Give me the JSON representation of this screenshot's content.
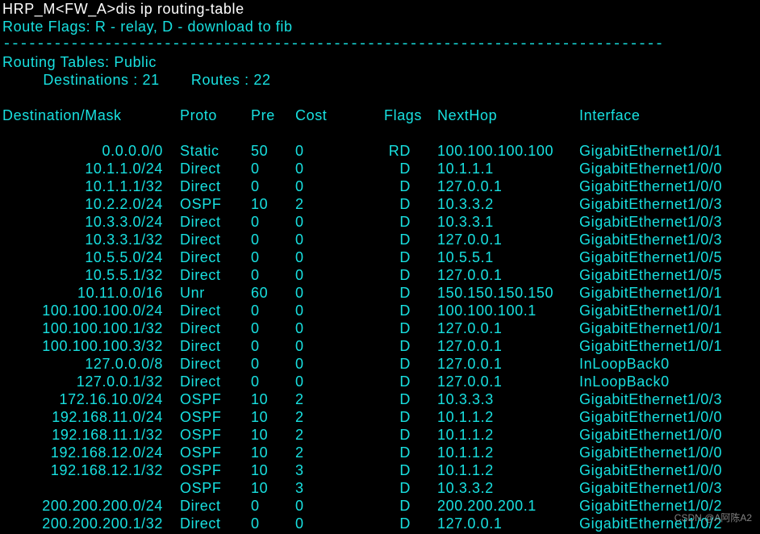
{
  "terminal": {
    "prompt": "HRP_M<FW_A>",
    "command": "dis ip routing-table",
    "flags_legend": "Route Flags: R - relay, D - download to fib",
    "rule": "------------------------------------------------------------------------------",
    "tables_title": "Routing Tables: Public",
    "summary": "         Destinations : 21       Routes : 22",
    "headers": {
      "dest": "Destination/Mask",
      "proto": "Proto",
      "pre": "Pre",
      "cost": "Cost",
      "flags": "Flags",
      "nexthop": "NextHop",
      "interface": "Interface"
    },
    "routes": [
      {
        "dest": "0.0.0.0/0",
        "proto": "Static",
        "pre": "50",
        "cost": "0",
        "flags": "RD",
        "nexthop": "100.100.100.100",
        "iface": "GigabitEthernet1/0/1"
      },
      {
        "dest": "10.1.1.0/24",
        "proto": "Direct",
        "pre": "0",
        "cost": "0",
        "flags": "D",
        "nexthop": "10.1.1.1",
        "iface": "GigabitEthernet1/0/0"
      },
      {
        "dest": "10.1.1.1/32",
        "proto": "Direct",
        "pre": "0",
        "cost": "0",
        "flags": "D",
        "nexthop": "127.0.0.1",
        "iface": "GigabitEthernet1/0/0"
      },
      {
        "dest": "10.2.2.0/24",
        "proto": "OSPF",
        "pre": "10",
        "cost": "2",
        "flags": "D",
        "nexthop": "10.3.3.2",
        "iface": "GigabitEthernet1/0/3"
      },
      {
        "dest": "10.3.3.0/24",
        "proto": "Direct",
        "pre": "0",
        "cost": "0",
        "flags": "D",
        "nexthop": "10.3.3.1",
        "iface": "GigabitEthernet1/0/3"
      },
      {
        "dest": "10.3.3.1/32",
        "proto": "Direct",
        "pre": "0",
        "cost": "0",
        "flags": "D",
        "nexthop": "127.0.0.1",
        "iface": "GigabitEthernet1/0/3"
      },
      {
        "dest": "10.5.5.0/24",
        "proto": "Direct",
        "pre": "0",
        "cost": "0",
        "flags": "D",
        "nexthop": "10.5.5.1",
        "iface": "GigabitEthernet1/0/5"
      },
      {
        "dest": "10.5.5.1/32",
        "proto": "Direct",
        "pre": "0",
        "cost": "0",
        "flags": "D",
        "nexthop": "127.0.0.1",
        "iface": "GigabitEthernet1/0/5"
      },
      {
        "dest": "10.11.0.0/16",
        "proto": "Unr",
        "pre": "60",
        "cost": "0",
        "flags": "D",
        "nexthop": "150.150.150.150",
        "iface": "GigabitEthernet1/0/1"
      },
      {
        "dest": "100.100.100.0/24",
        "proto": "Direct",
        "pre": "0",
        "cost": "0",
        "flags": "D",
        "nexthop": "100.100.100.1",
        "iface": "GigabitEthernet1/0/1"
      },
      {
        "dest": "100.100.100.1/32",
        "proto": "Direct",
        "pre": "0",
        "cost": "0",
        "flags": "D",
        "nexthop": "127.0.0.1",
        "iface": "GigabitEthernet1/0/1"
      },
      {
        "dest": "100.100.100.3/32",
        "proto": "Direct",
        "pre": "0",
        "cost": "0",
        "flags": "D",
        "nexthop": "127.0.0.1",
        "iface": "GigabitEthernet1/0/1"
      },
      {
        "dest": "127.0.0.0/8",
        "proto": "Direct",
        "pre": "0",
        "cost": "0",
        "flags": "D",
        "nexthop": "127.0.0.1",
        "iface": "InLoopBack0"
      },
      {
        "dest": "127.0.0.1/32",
        "proto": "Direct",
        "pre": "0",
        "cost": "0",
        "flags": "D",
        "nexthop": "127.0.0.1",
        "iface": "InLoopBack0"
      },
      {
        "dest": "172.16.10.0/24",
        "proto": "OSPF",
        "pre": "10",
        "cost": "2",
        "flags": "D",
        "nexthop": "10.3.3.3",
        "iface": "GigabitEthernet1/0/3"
      },
      {
        "dest": "192.168.11.0/24",
        "proto": "OSPF",
        "pre": "10",
        "cost": "2",
        "flags": "D",
        "nexthop": "10.1.1.2",
        "iface": "GigabitEthernet1/0/0"
      },
      {
        "dest": "192.168.11.1/32",
        "proto": "OSPF",
        "pre": "10",
        "cost": "2",
        "flags": "D",
        "nexthop": "10.1.1.2",
        "iface": "GigabitEthernet1/0/0"
      },
      {
        "dest": "192.168.12.0/24",
        "proto": "OSPF",
        "pre": "10",
        "cost": "2",
        "flags": "D",
        "nexthop": "10.1.1.2",
        "iface": "GigabitEthernet1/0/0"
      },
      {
        "dest": "192.168.12.1/32",
        "proto": "OSPF",
        "pre": "10",
        "cost": "3",
        "flags": "D",
        "nexthop": "10.1.1.2",
        "iface": "GigabitEthernet1/0/0"
      },
      {
        "dest": "",
        "proto": "OSPF",
        "pre": "10",
        "cost": "3",
        "flags": "D",
        "nexthop": "10.3.3.2",
        "iface": "GigabitEthernet1/0/3"
      },
      {
        "dest": "200.200.200.0/24",
        "proto": "Direct",
        "pre": "0",
        "cost": "0",
        "flags": "D",
        "nexthop": "200.200.200.1",
        "iface": "GigabitEthernet1/0/2"
      },
      {
        "dest": "200.200.200.1/32",
        "proto": "Direct",
        "pre": "0",
        "cost": "0",
        "flags": "D",
        "nexthop": "127.0.0.1",
        "iface": "GigabitEthernet1/0/2"
      }
    ],
    "watermark": "CSDN @A阿陈A2"
  },
  "colors": {
    "background": "#000000",
    "prompt_text": "#ffffff",
    "output_text": "#18e0e0"
  }
}
